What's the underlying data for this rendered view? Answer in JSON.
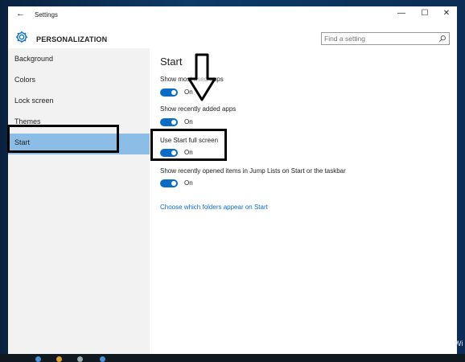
{
  "window": {
    "title": "Settings",
    "back_glyph": "←",
    "controls": {
      "minimize": "—",
      "maximize": "☐",
      "close": "✕"
    }
  },
  "header": {
    "section_title": "PERSONALIZATION",
    "section_icon": "gear-icon",
    "search": {
      "placeholder": "Find a setting",
      "value": ""
    }
  },
  "sidebar": {
    "items": [
      {
        "label": "Background",
        "active": false
      },
      {
        "label": "Colors",
        "active": false
      },
      {
        "label": "Lock screen",
        "active": false
      },
      {
        "label": "Themes",
        "active": false
      },
      {
        "label": "Start",
        "active": true
      }
    ]
  },
  "content": {
    "title": "Start",
    "settings": [
      {
        "label": "Show most used apps",
        "state": "On"
      },
      {
        "label": "Show recently added apps",
        "state": "On"
      },
      {
        "label": "Use Start full screen",
        "state": "On"
      },
      {
        "label": "Show recently opened items in Jump Lists on Start or the taskbar",
        "state": "On"
      }
    ],
    "link": "Choose which folders appear on Start"
  },
  "colors": {
    "accent": "#0b6cc8",
    "sidebar_selected": "#8bbde6",
    "sidebar_bg": "#f2f2f2"
  },
  "desktop": {
    "watermark": "Wi"
  }
}
